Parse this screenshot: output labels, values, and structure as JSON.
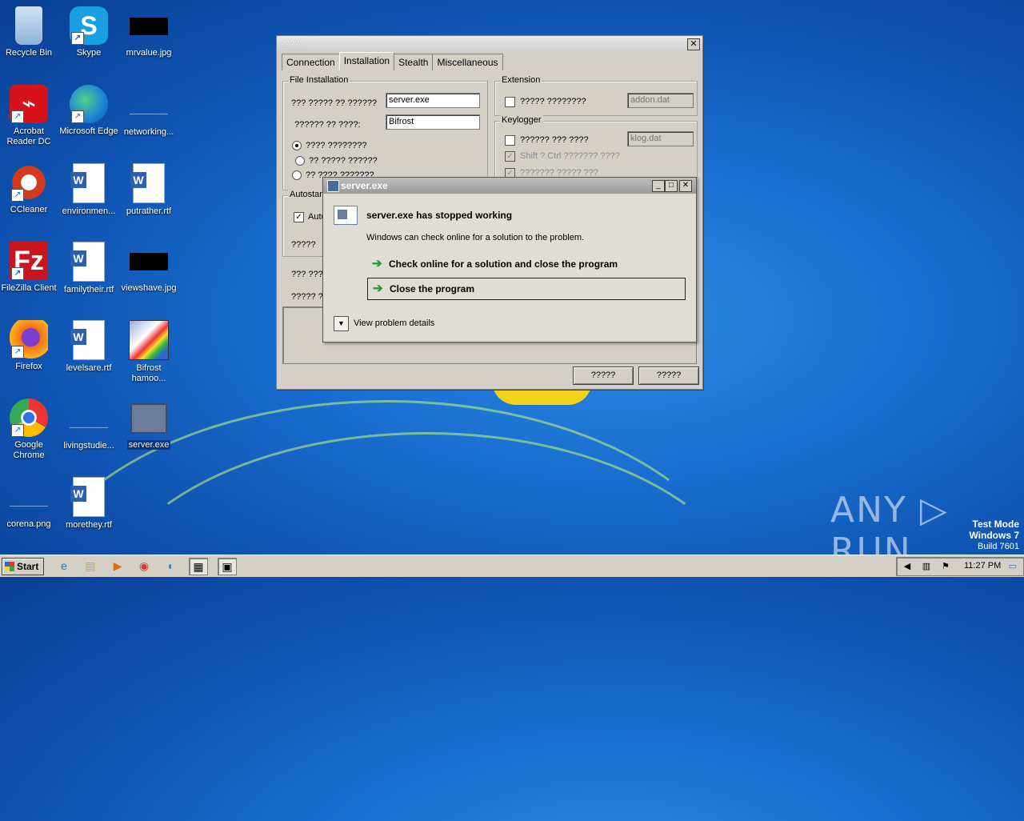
{
  "desktop": {
    "icons": [
      {
        "label": "Recycle Bin"
      },
      {
        "label": "Skype"
      },
      {
        "label": "mrvalue.jpg"
      },
      {
        "label": "Acrobat Reader DC"
      },
      {
        "label": "Microsoft Edge"
      },
      {
        "label": "networking..."
      },
      {
        "label": "CCleaner"
      },
      {
        "label": "environmen..."
      },
      {
        "label": "putrather.rtf"
      },
      {
        "label": "FileZilla Client"
      },
      {
        "label": "familytheir.rtf"
      },
      {
        "label": "viewshave.jpg"
      },
      {
        "label": "Firefox"
      },
      {
        "label": "levelsare.rtf"
      },
      {
        "label": "Bifrost hamoo..."
      },
      {
        "label": "Google Chrome"
      },
      {
        "label": "livingstudie..."
      },
      {
        "label": "server.exe"
      },
      {
        "label": "corena.png"
      },
      {
        "label": "morethey.rtf"
      }
    ],
    "watermark": "ANY ▷ RUN",
    "test_mode": {
      "line1": "Test Mode",
      "line2": "Windows 7",
      "line3": "Build 7601"
    }
  },
  "app_window": {
    "title": "?????",
    "close": "✕",
    "tabs": [
      {
        "label": "Connection"
      },
      {
        "label": "Installation",
        "active": true
      },
      {
        "label": "Stealth"
      },
      {
        "label": "Miscellaneous"
      }
    ],
    "file_installation": {
      "title": "File Installation",
      "filename_label": "??? ????? ?? ??????",
      "filename_value": "server.exe",
      "dir_label": "?????? ?? ????:",
      "dir_value": "Bifrost",
      "radio1": "???? ????????",
      "radio2": "?? ????? ??????",
      "radio3": "?? ???? ???????"
    },
    "extension": {
      "title": "Extension",
      "check_label": "????? ????????",
      "value": "addon.dat"
    },
    "keylogger": {
      "title": "Keylogger",
      "check_label": "?????? ??? ????",
      "value": "klog.dat",
      "shift_label": "Shift ? Ctrl ??????? ????",
      "other_label": "??????? ????? ???"
    },
    "autostart": {
      "title": "Autostart",
      "check_label": "Auto",
      "field_label": "?????"
    },
    "lower_label1": "??? ???",
    "lower_label2": "????? ?",
    "button1": "?????",
    "button2": "?????"
  },
  "error_dialog": {
    "title": "server.exe",
    "heading": "server.exe has stopped working",
    "message": "Windows can check online for a solution to the problem.",
    "option1": "Check online for a solution and close the program",
    "option2": "Close the program",
    "details": "View problem details",
    "min": "_",
    "max": "□",
    "close": "✕"
  },
  "taskbar": {
    "start": "Start",
    "clock": "11:27 PM"
  }
}
